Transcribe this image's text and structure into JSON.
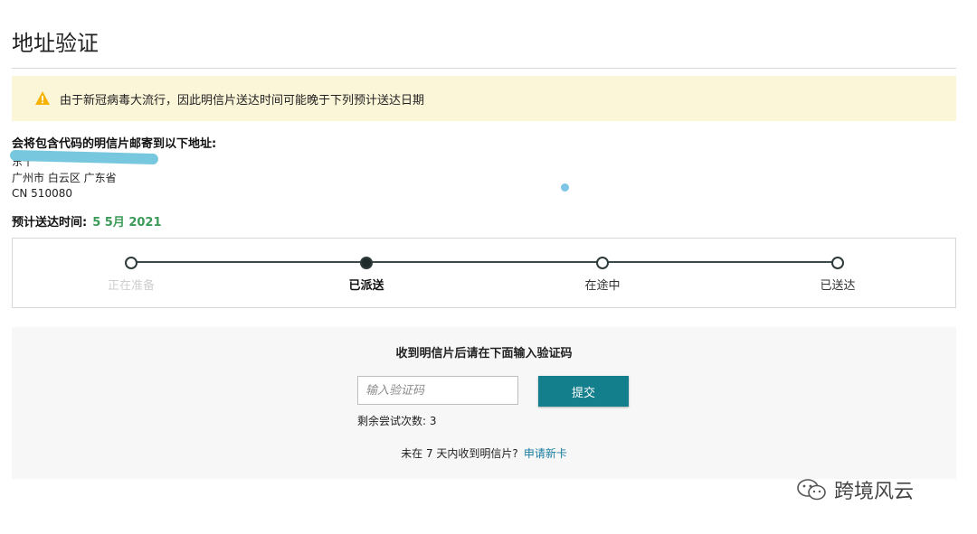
{
  "page": {
    "title": "地址验证"
  },
  "notice": {
    "icon": "warning-icon",
    "text": "由于新冠病毒大流行，因此明信片送达时间可能晚于下列预计送达日期",
    "icon_color": "#f5b300",
    "background": "#fcf6d8"
  },
  "address": {
    "heading": "会将包含代码的明信片邮寄到以下地址:",
    "line1_partial": "东十",
    "line2": "广州市 白云区 广东省",
    "line3": "CN 510080"
  },
  "eta": {
    "label": "预计送达时间:",
    "value": "5 5月 2021",
    "value_color": "#3a9a58"
  },
  "tracker": {
    "steps": [
      {
        "label": "正在准备",
        "state": "done"
      },
      {
        "label": "已派送",
        "state": "current"
      },
      {
        "label": "在途中",
        "state": "pending"
      },
      {
        "label": "已送达",
        "state": "pending"
      }
    ]
  },
  "verify": {
    "title": "收到明信片后请在下面输入验证码",
    "input_placeholder": "输入验证码",
    "submit_label": "提交",
    "attempts_text": "剩余尝试次数: 3",
    "not_received_text": "未在 7 天内收到明信片?",
    "request_link": "申请新卡",
    "accent": "#137e8c"
  },
  "watermark": {
    "icon": "wechat-icon",
    "text": "跨境风云"
  }
}
